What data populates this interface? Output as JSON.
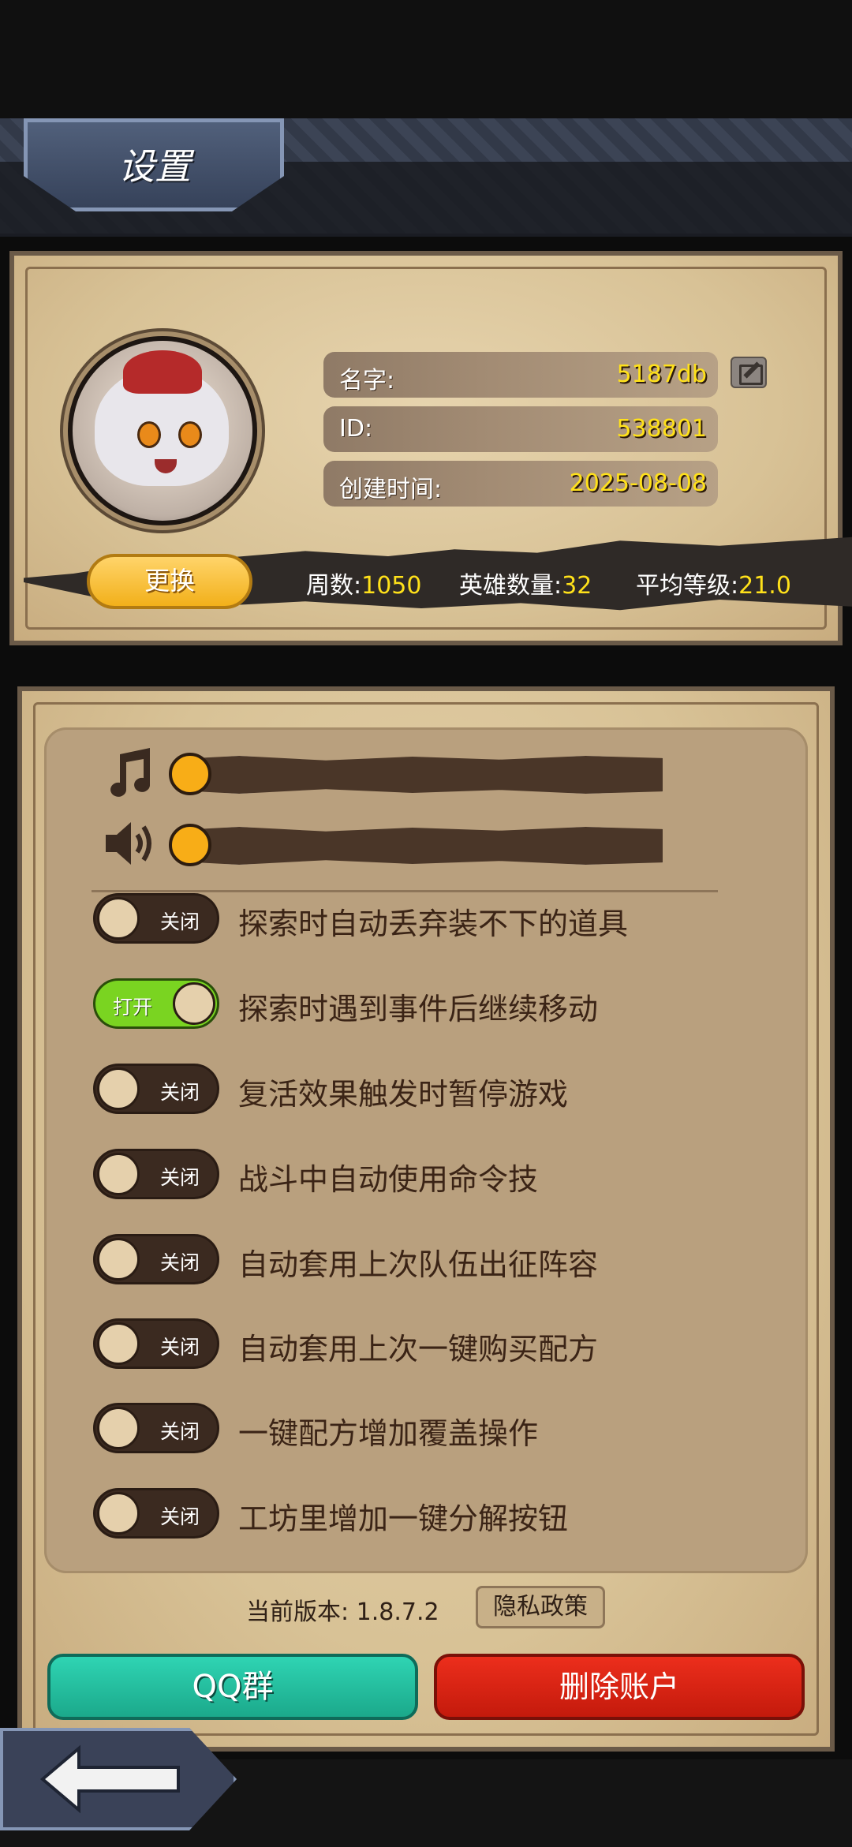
{
  "header": {
    "title": "设置"
  },
  "profile": {
    "name_label": "名字:",
    "name_value": "5187db",
    "id_label": "ID:",
    "id_value": "538801",
    "created_label": "创建时间:",
    "created_value": "2025-08-08",
    "swap_button": "更换"
  },
  "stats": {
    "weeks_label": "周数:",
    "weeks_value": "1050",
    "heroes_label": "英雄数量:",
    "heroes_value": "32",
    "avg_level_label": "平均等级:",
    "avg_level_value": "21.0"
  },
  "audio": {
    "music_level": 0,
    "sfx_level": 0,
    "music_icon": "music-note-icon",
    "sfx_icon": "speaker-icon"
  },
  "toggles": [
    {
      "state_label": "关闭",
      "on": false,
      "text": "探索时自动丢弃装不下的道具"
    },
    {
      "state_label": "打开",
      "on": true,
      "text": "探索时遇到事件后继续移动"
    },
    {
      "state_label": "关闭",
      "on": false,
      "text": "复活效果触发时暂停游戏"
    },
    {
      "state_label": "关闭",
      "on": false,
      "text": "战斗中自动使用命令技"
    },
    {
      "state_label": "关闭",
      "on": false,
      "text": "自动套用上次队伍出征阵容"
    },
    {
      "state_label": "关闭",
      "on": false,
      "text": "自动套用上次一键购买配方"
    },
    {
      "state_label": "关闭",
      "on": false,
      "text": "一键配方增加覆盖操作"
    },
    {
      "state_label": "关闭",
      "on": false,
      "text": "工坊里增加一键分解按钮"
    }
  ],
  "footer": {
    "version_text": "当前版本: 1.8.7.2",
    "privacy_button": "隐私政策",
    "qq_button": "QQ群",
    "delete_button": "删除账户"
  },
  "colors": {
    "accent_gold": "#ffe11a",
    "toggle_on": "#7ad421",
    "qq_teal": "#1ba98b",
    "delete_red": "#d3210f"
  }
}
